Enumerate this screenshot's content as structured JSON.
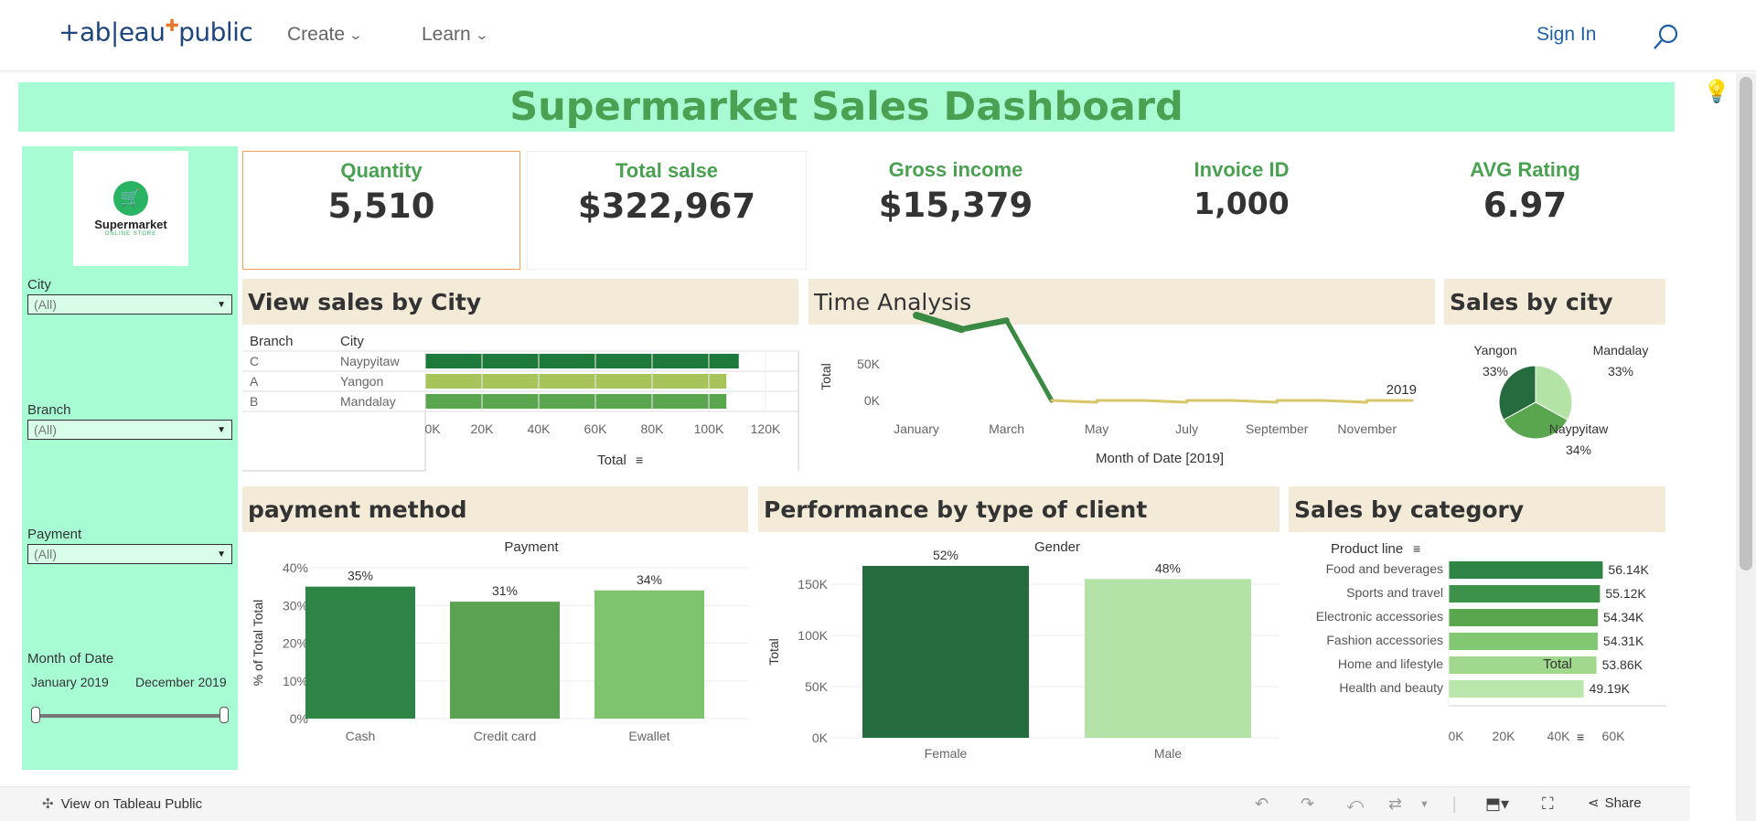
{
  "header": {
    "logo_text": "+ab|eau",
    "logo_suffix": "public",
    "nav": [
      {
        "label": "Create"
      },
      {
        "label": "Learn"
      }
    ],
    "signin_label": "Sign In"
  },
  "dashboard": {
    "title": "Supermarket Sales Dashboard",
    "logo_brand": "Supermarket",
    "logo_sub": "ONLINE STORE",
    "filters": {
      "city_label": "City",
      "city_value": "(All)",
      "branch_label": "Branch",
      "branch_value": "(All)",
      "payment_label": "Payment",
      "payment_value": "(All)",
      "date_label": "Month of Date",
      "date_start": "January 2019",
      "date_end": "December 2019"
    },
    "kpis": [
      {
        "label": "Quantity",
        "value": "5,510"
      },
      {
        "label": "Total salse",
        "value": "$322,967"
      },
      {
        "label": "Gross income",
        "value": "$15,379"
      },
      {
        "label": "Invoice ID",
        "value": "1,000"
      },
      {
        "label": "AVG Rating",
        "value": "6.97"
      }
    ],
    "panels": {
      "city": "View sales by City",
      "time": "Time Analysis",
      "sales_city": "Sales by city",
      "payment": "payment method",
      "client": "Performance by type of client",
      "category": "Sales by category"
    }
  },
  "chart_data": [
    {
      "type": "bar",
      "orientation": "horizontal",
      "title": "View sales by City",
      "columns": [
        "Branch",
        "City"
      ],
      "rows": [
        {
          "branch": "C",
          "city": "Naypyitaw",
          "value": 110569
        },
        {
          "branch": "A",
          "city": "Yangon",
          "value": 106200
        },
        {
          "branch": "B",
          "city": "Mandalay",
          "value": 106198
        }
      ],
      "xlabel": "Total",
      "xticks": [
        "0K",
        "20K",
        "40K",
        "60K",
        "80K",
        "100K",
        "120K"
      ],
      "xlim": [
        0,
        120000
      ],
      "colors": [
        "#1e7a3a",
        "#a6c45a",
        "#5aa64f"
      ]
    },
    {
      "type": "line",
      "title": "Time Analysis",
      "x": [
        "January",
        "February",
        "March",
        "April",
        "May",
        "June",
        "July",
        "August",
        "September",
        "October",
        "November",
        "December"
      ],
      "values": [
        116292,
        97219,
        109456,
        0,
        0,
        0,
        0,
        0,
        0,
        0,
        0,
        0
      ],
      "xticks": [
        "January",
        "March",
        "May",
        "July",
        "September",
        "November"
      ],
      "yticks": [
        "0K",
        "50K"
      ],
      "ylabel": "Total",
      "xlabel": "Month of Date [2019]",
      "annotation": "2019"
    },
    {
      "type": "pie",
      "title": "Sales by city",
      "slices": [
        {
          "label": "Yangon",
          "pct": "33%",
          "value": 33,
          "color": "#256b3e"
        },
        {
          "label": "Mandalay",
          "pct": "33%",
          "value": 33,
          "color": "#b3e3a6"
        },
        {
          "label": "Naypyitaw",
          "pct": "34%",
          "value": 34,
          "color": "#5aa64f"
        }
      ]
    },
    {
      "type": "bar",
      "title": "payment method",
      "header": "Payment",
      "categories": [
        "Cash",
        "Credit card",
        "Ewallet"
      ],
      "values": [
        35,
        31,
        34
      ],
      "labels": [
        "35%",
        "31%",
        "34%"
      ],
      "ylabel": "% of Total Total",
      "yticks": [
        "0%",
        "10%",
        "20%",
        "30%",
        "40%"
      ],
      "ylim": [
        0,
        40
      ],
      "colors": [
        "#2e8445",
        "#5ba352",
        "#7fc46c"
      ]
    },
    {
      "type": "bar",
      "title": "Performance by type of client",
      "header": "Gender",
      "categories": [
        "Female",
        "Male"
      ],
      "values": [
        167883,
        155084
      ],
      "labels": [
        "52%",
        "48%"
      ],
      "ylabel": "Total",
      "yticks": [
        "0K",
        "50K",
        "100K",
        "150K"
      ],
      "ylim": [
        0,
        160000
      ],
      "colors": [
        "#246b3d",
        "#b3e3a6"
      ]
    },
    {
      "type": "bar",
      "orientation": "horizontal",
      "title": "Sales by category",
      "header": "Product line",
      "categories": [
        "Food and beverages",
        "Sports and travel",
        "Electronic accessories",
        "Fashion accessories",
        "Home and lifestyle",
        "Health and beauty"
      ],
      "values": [
        56.14,
        55.12,
        54.34,
        54.31,
        53.86,
        49.19
      ],
      "labels": [
        "56.14K",
        "55.12K",
        "54.34K",
        "54.31K",
        "53.86K",
        "49.19K"
      ],
      "xlabel": "Total",
      "xticks": [
        "0K",
        "20K",
        "40K",
        "60K"
      ],
      "xlim": [
        0,
        60
      ],
      "colors": [
        "#2e8445",
        "#3c9248",
        "#5aa64f",
        "#82c771",
        "#a0d88e",
        "#b8e7a9"
      ]
    }
  ],
  "footer": {
    "view_on": "View on Tableau Public",
    "share": "Share"
  }
}
